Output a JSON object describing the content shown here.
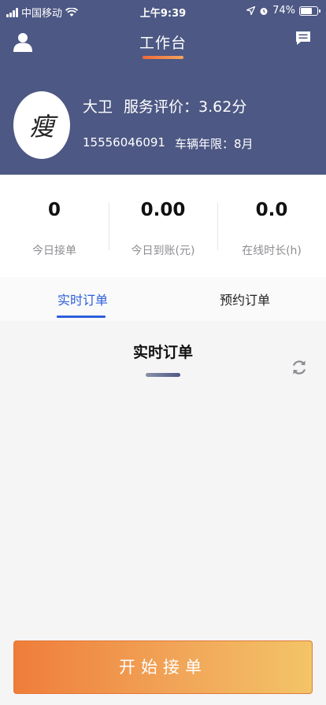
{
  "status_bar": {
    "carrier": "中国移动",
    "time": "上午9:39",
    "battery_percent": "74%",
    "battery_level": 0.74
  },
  "nav": {
    "title": "工作台"
  },
  "profile": {
    "avatar_text": "瘦",
    "name": "大卫",
    "rating_label": "服务评价：3.62分",
    "phone": "15556046091",
    "vehicle_years": "车辆年限：8月"
  },
  "stats": [
    {
      "value": "0",
      "label": "今日接单"
    },
    {
      "value": "0.00",
      "label": "今日到账(元)"
    },
    {
      "value": "0.0",
      "label": "在线时长(h)"
    }
  ],
  "tabs": [
    {
      "label": "实时订单",
      "active": true
    },
    {
      "label": "预约订单",
      "active": false
    }
  ],
  "section": {
    "title": "实时订单"
  },
  "action": {
    "start_label": "开始接单"
  },
  "colors": {
    "header_bg": "#4d5884",
    "accent_blue": "#2c5ed9",
    "orange_start": "#ef7d3a",
    "orange_end": "#f3c467"
  },
  "icons": {
    "user": "person-icon",
    "message": "chat-icon",
    "refresh": "refresh-icon"
  }
}
